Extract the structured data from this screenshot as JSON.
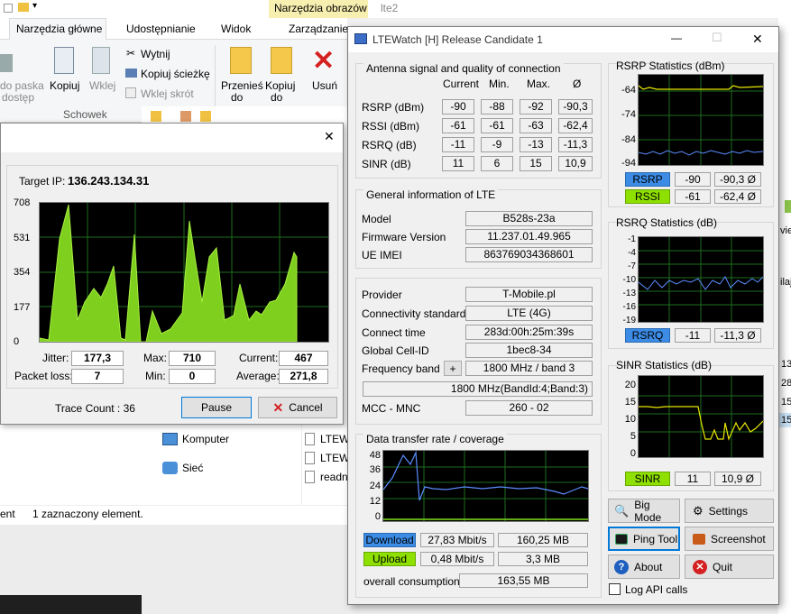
{
  "explorer": {
    "ribbon_tabs": [
      "Narzędzia główne",
      "Udostępnianie",
      "Widok",
      "Zarządzanie"
    ],
    "context_tab": "Narzędzia obrazów",
    "title_fragment": "lte2",
    "buttons": {
      "pin": "do paska",
      "pin2": "dostęp",
      "copy": "Kopiuj",
      "paste": "Wklej",
      "cut": "Wytnij",
      "copy_path": "Kopiuj ścieżkę",
      "paste_shortcut": "Wklej skrót",
      "move": "Przenieś",
      "move2": "do",
      "copyto": "Kopiuj",
      "copyto2": "do",
      "delete": "Usuń"
    },
    "group_label": "Schowek",
    "nav": [
      {
        "label": "Komputer",
        "icon": "computer-icon"
      },
      {
        "label": "Sieć",
        "icon": "network-icon"
      }
    ],
    "files": [
      "LTEW",
      "LTEW",
      "readn"
    ],
    "status": {
      "left": "ent",
      "selected": "1 zaznaczony element."
    },
    "side_nums": [
      "13",
      "28",
      "15",
      "15"
    ],
    "side_texts": [
      "vie",
      "ilaj"
    ]
  },
  "ping": {
    "target_label": "Target IP:",
    "target_ip": "136.243.134.31",
    "yticks": [
      "708",
      "531",
      "354",
      "177",
      "0"
    ],
    "stats": {
      "jitter_label": "Jitter:",
      "jitter": "177,3",
      "max_label": "Max:",
      "max": "710",
      "current_label": "Current:",
      "current": "467",
      "loss_label": "Packet loss:",
      "loss": "7",
      "min_label": "Min:",
      "min": "0",
      "avg_label": "Average:",
      "avg": "271,8"
    },
    "trace": "Trace Count : 36",
    "pause": "Pause",
    "cancel": "Cancel",
    "close_glyph": "✕"
  },
  "lte": {
    "title": "LTEWatch [H]   Release Candidate 1",
    "controls": {
      "min": "—",
      "max": "☐",
      "close": "✕"
    },
    "antenna": {
      "title": "Antenna signal and quality of connection",
      "headers": [
        "Current",
        "Min.",
        "Max.",
        "Ø"
      ],
      "rows": [
        {
          "label": "RSRP (dBm)",
          "vals": [
            "-90",
            "-88",
            "-92",
            "-90,3"
          ]
        },
        {
          "label": "RSSI (dBm)",
          "vals": [
            "-61",
            "-61",
            "-63",
            "-62,4"
          ]
        },
        {
          "label": "RSRQ (dB)",
          "vals": [
            "-11",
            "-9",
            "-13",
            "-11,3"
          ]
        },
        {
          "label": "SINR (dB)",
          "vals": [
            "11",
            "6",
            "15",
            "10,9"
          ]
        }
      ]
    },
    "general": {
      "title": "General information of LTE",
      "rows": [
        {
          "label": "Model",
          "value": "B528s-23a"
        },
        {
          "label": "Firmware Version",
          "value": "11.237.01.49.965"
        },
        {
          "label": "UE IMEI",
          "value": "863769034368601"
        }
      ]
    },
    "provider": {
      "rows": [
        {
          "label": "Provider",
          "value": "T-Mobile.pl"
        },
        {
          "label": "Connectivity standard",
          "value": "LTE (4G)"
        },
        {
          "label": "Connect time",
          "value": "283d:00h:25m:39s"
        },
        {
          "label": "Global Cell-ID",
          "value": "1bec8-34"
        },
        {
          "label": "Frequency band",
          "value": "1800 MHz / band 3"
        }
      ],
      "plus": "+",
      "band_detail": "1800 MHz(BandId:4;Band:3)",
      "mcc_label": "MCC - MNC",
      "mcc": "260 - 02"
    },
    "transfer": {
      "title": "Data transfer rate / coverage",
      "yticks": [
        "48",
        "36",
        "24",
        "12",
        "0"
      ],
      "download_label": "Download",
      "download_rate": "27,83 Mbit/s",
      "download_total": "160,25 MB",
      "upload_label": "Upload",
      "upload_rate": "0,48 Mbit/s",
      "upload_total": "3,3 MB",
      "overall_label": "overall consumption",
      "overall": "163,55 MB"
    },
    "rsrp_stats": {
      "title": "RSRP Statistics (dBm)",
      "yticks": [
        "-64",
        "-74",
        "-84",
        "-94"
      ],
      "rsrp_label": "RSRP",
      "rsrp": "-90",
      "rsrp_avg": "-90,3 Ø",
      "rssi_label": "RSSI",
      "rssi": "-61",
      "rssi_avg": "-62,4 Ø"
    },
    "rsrq_stats": {
      "title": "RSRQ Statistics (dB)",
      "yticks": [
        "-1",
        "-4",
        "-7",
        "-10",
        "-13",
        "-16",
        "-19"
      ],
      "label": "RSRQ",
      "val": "-11",
      "avg": "-11,3 Ø"
    },
    "sinr_stats": {
      "title": "SINR Statistics (dB)",
      "yticks": [
        "20",
        "15",
        "10",
        "5",
        "0"
      ],
      "label": "SINR",
      "val": "11",
      "avg": "10,9 Ø"
    },
    "buttons": {
      "big": "Big Mode",
      "settings": "Settings",
      "ping": "Ping Tool",
      "screenshot": "Screenshot",
      "about": "About",
      "quit": "Quit"
    },
    "log_api": "Log API calls"
  },
  "colors": {
    "chart_bg": "#000000",
    "grid": "#1e6e1e",
    "green_fill": "#7fcf1f",
    "blue_line": "#5b8cff",
    "yellow_line": "#e8e800",
    "blue_label": "#3c8ce6",
    "green_label": "#8ee000"
  }
}
